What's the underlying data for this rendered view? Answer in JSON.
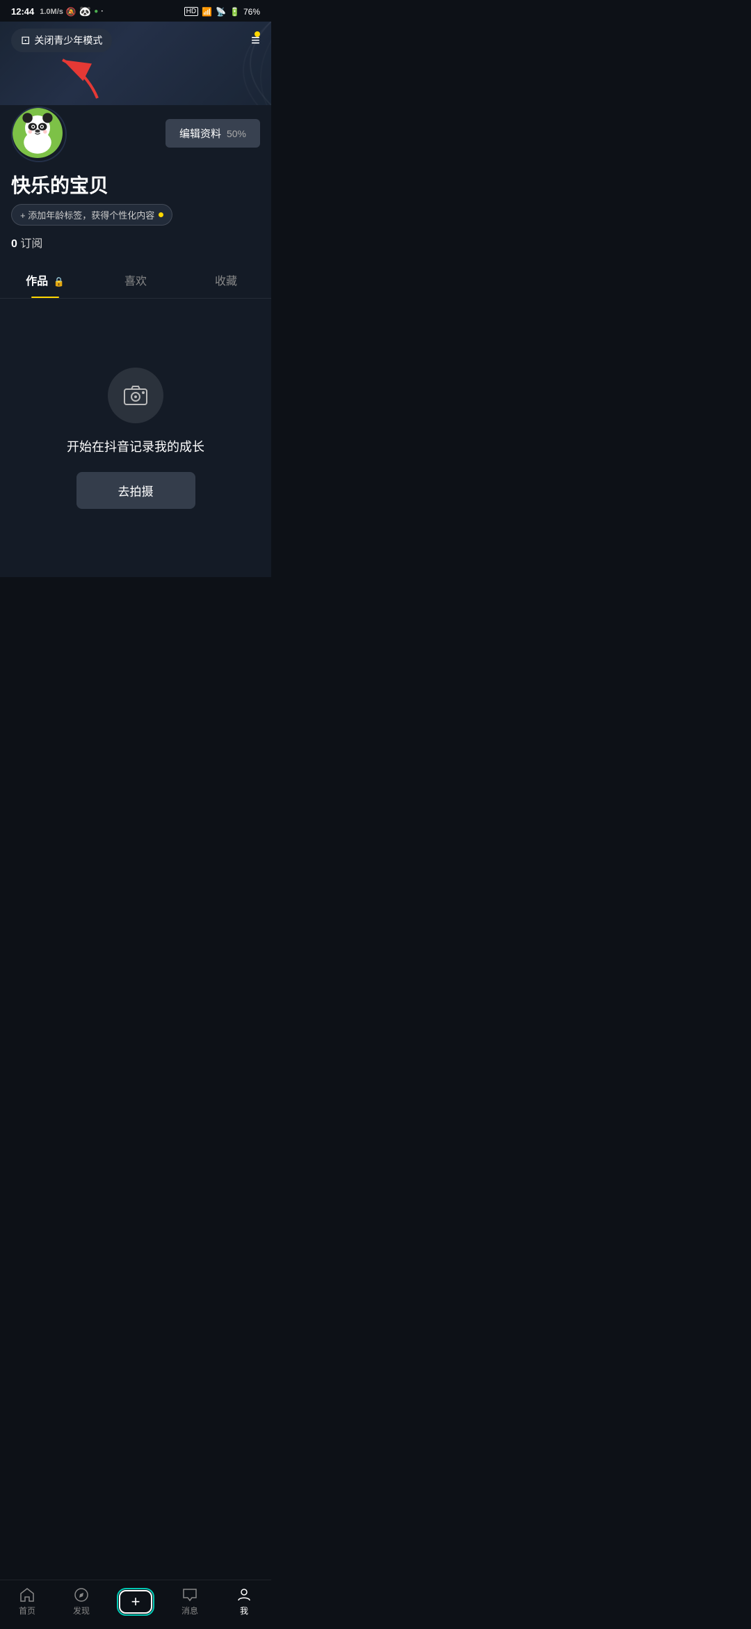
{
  "statusBar": {
    "time": "12:44",
    "speed": "1.0M/s",
    "battery": "76%"
  },
  "header": {
    "youthModeLabel": "关闭青少年模式",
    "menuIcon": "≡"
  },
  "profile": {
    "username": "快乐的宝贝",
    "editLabel": "编辑资料",
    "editPercent": "50%",
    "ageTagLabel": "+ 添加年龄标签，获得个性化内容",
    "subscribeCount": "0",
    "subscribeLabel": "订阅"
  },
  "tabs": [
    {
      "label": "作品",
      "locked": true,
      "active": true
    },
    {
      "label": "喜欢",
      "locked": false,
      "active": false
    },
    {
      "label": "收藏",
      "locked": false,
      "active": false
    }
  ],
  "emptyState": {
    "text": "开始在抖音记录我的成长",
    "buttonLabel": "去拍摄"
  },
  "bottomNav": [
    {
      "label": "首页",
      "active": false
    },
    {
      "label": "发现",
      "active": false
    },
    {
      "label": "+",
      "active": false,
      "isPlus": true
    },
    {
      "label": "消息",
      "active": false
    },
    {
      "label": "我",
      "active": true
    }
  ]
}
